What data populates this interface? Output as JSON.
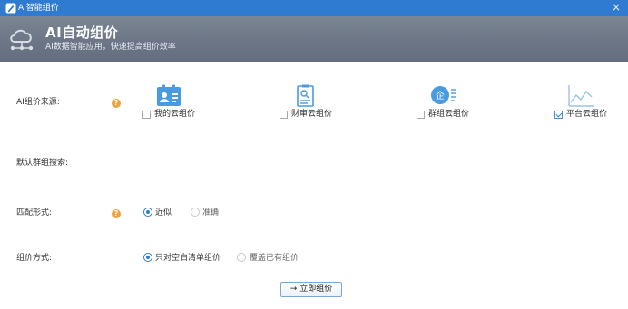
{
  "window": {
    "title": "AI智能组价",
    "app_icon": "pencil-app-icon",
    "close_icon": "close-icon",
    "close_glyph": "×"
  },
  "banner": {
    "title": "AI自动组价",
    "subtitle": "AI数据智能应用，快速提高组价效率",
    "logo_icon": "cloud-network-icon"
  },
  "help_glyph": "?",
  "form": {
    "source": {
      "label": "AI组价来源:",
      "options": [
        {
          "label": "我的云组价",
          "icon": "contact-card-icon",
          "checked": false
        },
        {
          "label": "财审云组价",
          "icon": "audit-document-icon",
          "checked": false
        },
        {
          "label": "群组云组价",
          "icon": "enterprise-group-icon",
          "checked": false
        },
        {
          "label": "平台云组价",
          "icon": "line-chart-icon",
          "checked": true
        }
      ]
    },
    "group_search": {
      "label": "默认群组搜索:"
    },
    "match": {
      "label": "匹配形式:",
      "options": [
        {
          "label": "近似",
          "selected": true
        },
        {
          "label": "准确",
          "selected": false
        }
      ]
    },
    "mode": {
      "label": "组价方式:",
      "options": [
        {
          "label": "只对空白清单组价",
          "selected": true
        },
        {
          "label": "覆盖已有组价",
          "selected": false
        }
      ]
    },
    "submit": {
      "label": "立即组价",
      "icon": "arrow-right-icon",
      "glyph": "→"
    }
  },
  "colors": {
    "titlebar": "#2f7bd1",
    "banner": "#6c7686",
    "accent": "#2f7bd1",
    "help": "#f0a33a",
    "icon_blue": "#4a9ae0"
  }
}
